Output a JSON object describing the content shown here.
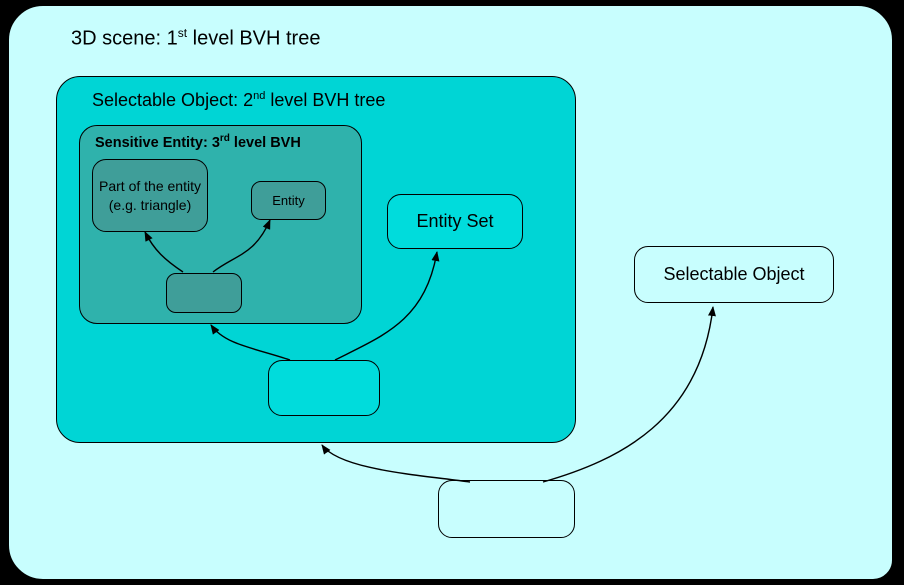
{
  "diagram": {
    "outer_title_pre": "3D scene: 1",
    "outer_title_sup": "st",
    "outer_title_post": " level BVH tree",
    "selectable_title_pre": "Selectable Object: 2",
    "selectable_title_sup": "nd",
    "selectable_title_post": " level BVH tree",
    "sensitive_title_pre": "Sensitive Entity: 3",
    "sensitive_title_sup": "rd",
    "sensitive_title_post": " level BVH",
    "part_label": "Part of the entity (e.g. triangle)",
    "entity_label": "Entity",
    "entity_set_label": "Entity Set",
    "selectable_object_label": "Selectable Object"
  }
}
